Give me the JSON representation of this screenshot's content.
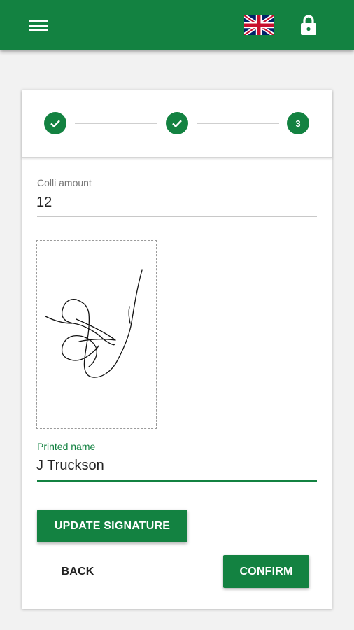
{
  "colors": {
    "primary": "#138241",
    "background": "#f2f2f2",
    "card": "#ffffff"
  },
  "header": {
    "menu_icon": "hamburger-menu-icon",
    "language_icon": "uk-flag-icon",
    "lock_icon": "lock-icon"
  },
  "stepper": {
    "steps": [
      {
        "state": "completed",
        "icon": "check-icon"
      },
      {
        "state": "completed",
        "icon": "check-icon"
      },
      {
        "state": "active",
        "label": "3"
      }
    ]
  },
  "form": {
    "colli_label": "Colli amount",
    "colli_value": "12",
    "printed_name_label": "Printed name",
    "printed_name_value": "J Truckson"
  },
  "buttons": {
    "update_signature": "UPDATE SIGNATURE",
    "back": "BACK",
    "confirm": "CONFIRM"
  }
}
